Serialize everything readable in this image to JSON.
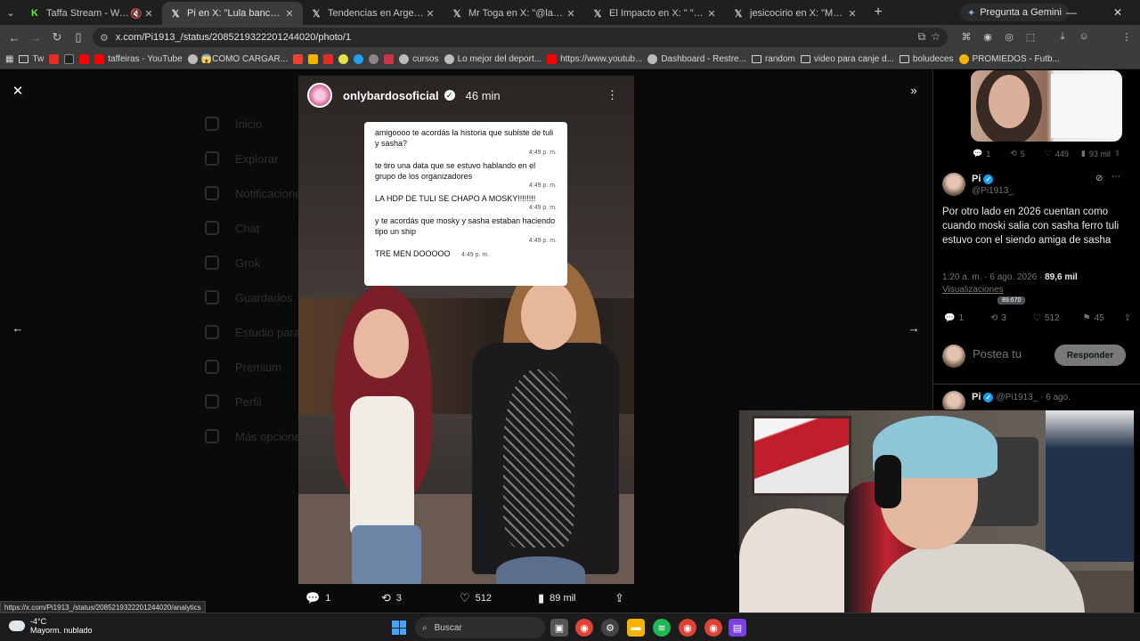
{
  "browser": {
    "tabs": [
      {
        "title": "Taffa Stream - Watch Live o",
        "favicon": "K",
        "color": "#53fc18"
      },
      {
        "title": "Pi en X: \"Lula banchero nunca",
        "favicon": "X",
        "color": "#ffffff"
      },
      {
        "title": "Tendencias en Argentina en X:",
        "favicon": "X",
        "color": "#ffffff"
      },
      {
        "title": "Mr Toga en X: \"@ladymoskign",
        "favicon": "X",
        "color": "#ffffff"
      },
      {
        "title": "El Impacto en X: \" \"INVENTA",
        "favicon": "X",
        "color": "#ffffff"
      },
      {
        "title": "jesicocirio en X: \"Martín Cirio c",
        "favicon": "X",
        "color": "#ffffff"
      }
    ],
    "gemini_label": "Pregunta a Gemini",
    "url": "x.com/Pi1913_/status/2085219322201244020/photo/1",
    "bookmarks": [
      {
        "label": "Tw",
        "kind": "folder"
      },
      {
        "label": "",
        "kind": "icon",
        "color": "#e52d27"
      },
      {
        "label": "",
        "kind": "icon",
        "color": "#222222"
      },
      {
        "label": "",
        "kind": "icon",
        "color": "#ff0000"
      },
      {
        "label": "taffeiras - YouTube",
        "kind": "icon",
        "color": "#ff0000"
      },
      {
        "label": "😱COMO CARGAR...",
        "kind": "icon",
        "color": "#bbbbbb"
      },
      {
        "label": "",
        "kind": "icon",
        "color": "#ea4335"
      },
      {
        "label": "",
        "kind": "icon",
        "color": "#f4b400"
      },
      {
        "label": "",
        "kind": "icon",
        "color": "#e52d27"
      },
      {
        "label": "",
        "kind": "icon",
        "color": "#e2e250"
      },
      {
        "label": "",
        "kind": "icon",
        "color": "#1da1f2"
      },
      {
        "label": "",
        "kind": "icon",
        "color": "#888888"
      },
      {
        "label": "",
        "kind": "icon",
        "color": "#cc3344"
      },
      {
        "label": "cursos",
        "kind": "icon",
        "color": "#bbbbbb"
      },
      {
        "label": "Lo mejor del deport...",
        "kind": "icon",
        "color": "#bbbbbb"
      },
      {
        "label": "https://www.youtub...",
        "kind": "icon",
        "color": "#ff0000"
      },
      {
        "label": "Dashboard - Restre...",
        "kind": "icon",
        "color": "#bbbbbb"
      },
      {
        "label": "random",
        "kind": "folder"
      },
      {
        "label": "video para canje d...",
        "kind": "folder"
      },
      {
        "label": "boludeces",
        "kind": "folder"
      },
      {
        "label": "PROMIEDOS - Futb...",
        "kind": "icon",
        "color": "#f4b400"
      }
    ]
  },
  "background_nav": [
    "Inicio",
    "Explorar",
    "Notificaciones",
    "Chat",
    "Grok",
    "Guardados",
    "Estudio para",
    "Premium",
    "Perfil",
    "Más opciones"
  ],
  "story": {
    "username": "onlybardosoficial",
    "time": "46 min",
    "messages": [
      {
        "text": "amigoooo te acordás la historia que subiste de tuli y sasha?",
        "time": "4:49 p. m."
      },
      {
        "text": "te tiro una data que se estuvo hablando en el grupo de los organizadores",
        "time": "4:49 p. m."
      },
      {
        "text": "LA HDP DE TULI SE CHAPO A MOSKY!!!!!!!!",
        "time": "4:49 p. m."
      },
      {
        "text": "y te acordás que mosky y sasha estaban haciendo tipo un ship",
        "time": "4:49 p. m."
      }
    ],
    "last_message": {
      "text": "TRE MEN DOOOOO",
      "time": "4:49 p. m."
    }
  },
  "photo_actions": {
    "replies": "1",
    "reposts": "3",
    "likes": "512",
    "views": "89 mil"
  },
  "right_panel": {
    "prev_post_stats": {
      "replies": "1",
      "reposts": "5",
      "likes": "449",
      "views": "93 mil"
    },
    "post": {
      "name": "Pi",
      "handle": "@Pi1913_",
      "text": "Por otro lado en 2026 cuentan como cuando moski salia con sasha ferro tuli estuvo con el siendo amiga de sasha",
      "datetime": "1:20 a. m. · 6 ago. 2026 · ",
      "views_count": "89,6 mil",
      "views_label": "Visualizaciones",
      "tooltip": "89.670",
      "stats": {
        "replies": "1",
        "reposts": "3",
        "likes": "512",
        "bookmarks": "45"
      }
    },
    "reply_placeholder": "Postea tu",
    "reply_button": "Responder",
    "next_post": {
      "name": "Pi",
      "handle": "@Pi1913_ · 6 ago."
    }
  },
  "status_url": "https://x.com/Pi1913_/status/2085219322201244020/analytics",
  "taskbar": {
    "temperature": "-4°C",
    "weather": "Mayorm. nublado",
    "search_label": "Buscar"
  }
}
